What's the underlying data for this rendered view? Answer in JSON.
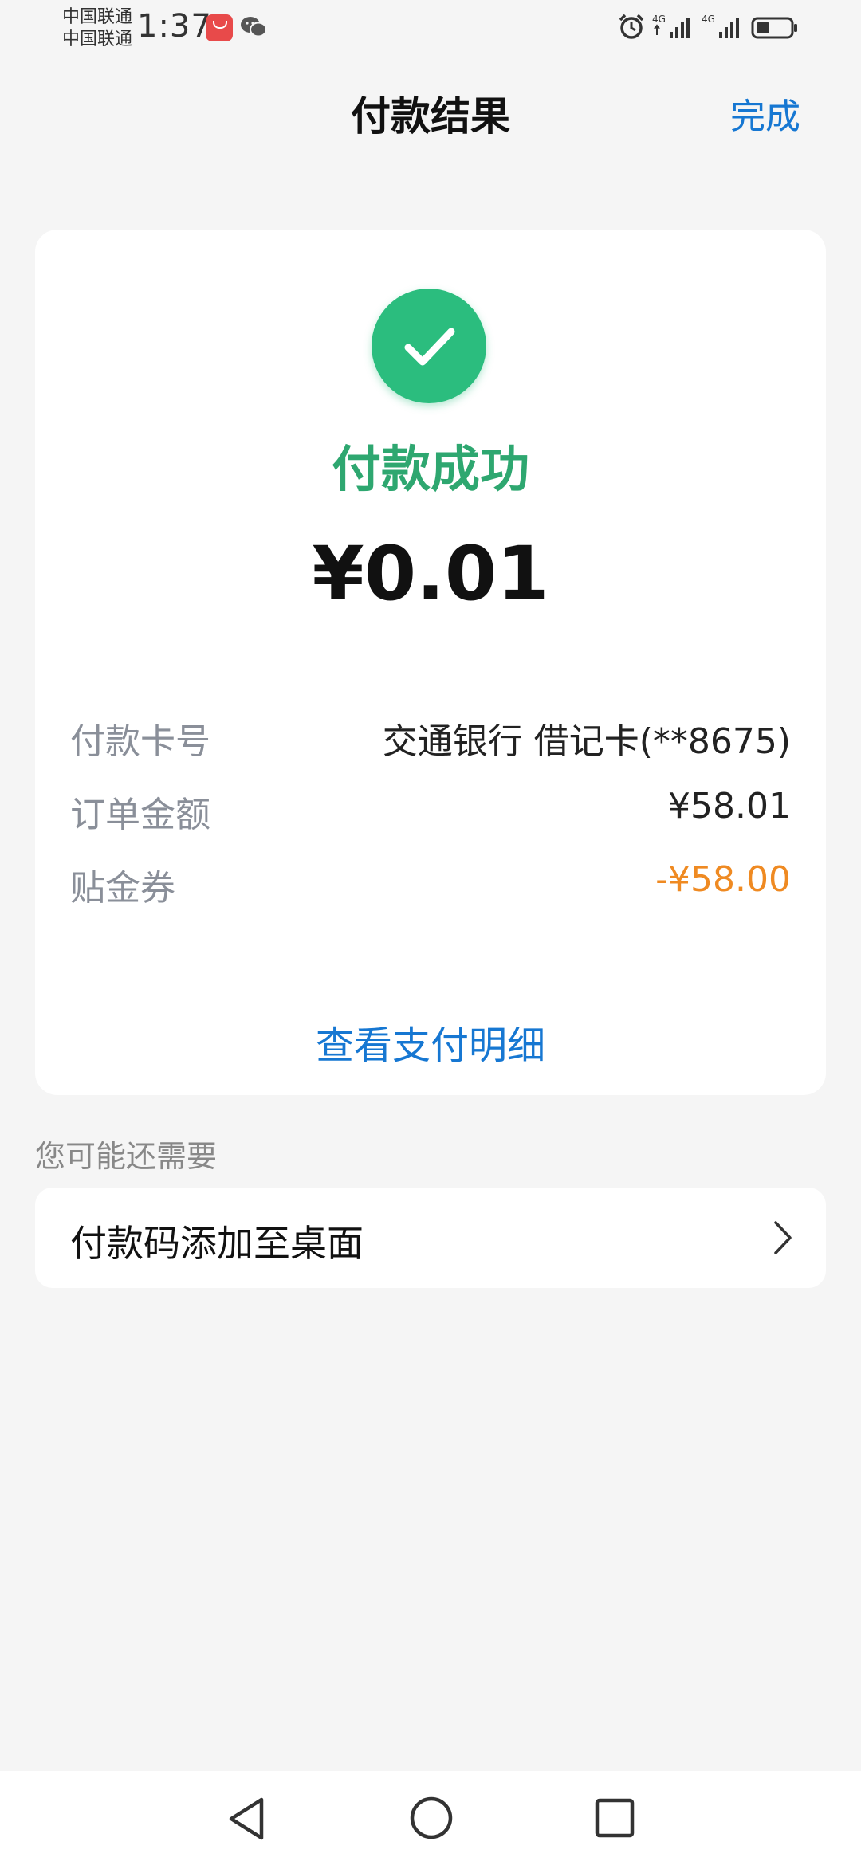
{
  "status_bar": {
    "carrier_1": "中国联通",
    "carrier_2": "中国联通",
    "time": "1:37",
    "icons": [
      "huawei-appgallery-icon",
      "wechat-icon",
      "alarm-icon",
      "signal-4g-icon",
      "signal-4g-icon",
      "battery-icon"
    ]
  },
  "header": {
    "title": "付款结果",
    "done_label": "完成"
  },
  "result": {
    "status_text": "付款成功",
    "amount": "¥0.01",
    "icon": "check-circle-icon"
  },
  "details": [
    {
      "label": "付款卡号",
      "value": "交通银行 借记卡(**8675)"
    },
    {
      "label": "订单金额",
      "value": "¥58.01"
    },
    {
      "label": "贴金券",
      "value": "-¥58.00"
    }
  ],
  "detail_link": "查看支付明细",
  "suggestions": {
    "title": "您可能还需要",
    "items": [
      {
        "label": "付款码添加至桌面"
      }
    ]
  },
  "colors": {
    "accent_blue": "#1677d2",
    "success_green": "#2ea770",
    "discount_orange": "#ef8a22",
    "background": "#f5f5f5"
  }
}
